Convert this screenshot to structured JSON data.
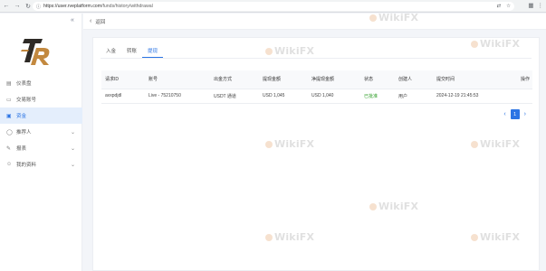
{
  "browser": {
    "url_host": "https://user.rveplatform.com",
    "url_path": "/funds/history/withdrawal"
  },
  "sidebar": {
    "items": [
      {
        "label": "仪表盘",
        "icon": "dashboard-icon"
      },
      {
        "label": "交易账号",
        "icon": "account-icon"
      },
      {
        "label": "资金",
        "icon": "wallet-icon",
        "active": true
      },
      {
        "label": "推荐人",
        "icon": "referral-icon",
        "caret": true
      },
      {
        "label": "报表",
        "icon": "report-icon",
        "caret": true
      },
      {
        "label": "我的资料",
        "icon": "profile-icon",
        "caret": true
      }
    ]
  },
  "header": {
    "back_label": "返回"
  },
  "tabs": [
    "入金",
    "转账",
    "提现"
  ],
  "active_tab": 2,
  "table": {
    "columns": [
      "请求ID",
      "账号",
      "出金方式",
      "提现金额",
      "净提现金额",
      "状态",
      "创建人",
      "提交时间",
      "操作"
    ],
    "rows": [
      [
        "avxpdjdl",
        "Live - 75210750",
        "USDT 通道",
        "USD 1,045",
        "USD 1,040",
        "已批准",
        "用户",
        "2024-12-19 21:45:53",
        ""
      ]
    ]
  },
  "pagination": {
    "current": "1"
  },
  "watermark": "WikiFX",
  "colors": {
    "accent": "#2b74e4",
    "success": "#33a02c"
  }
}
